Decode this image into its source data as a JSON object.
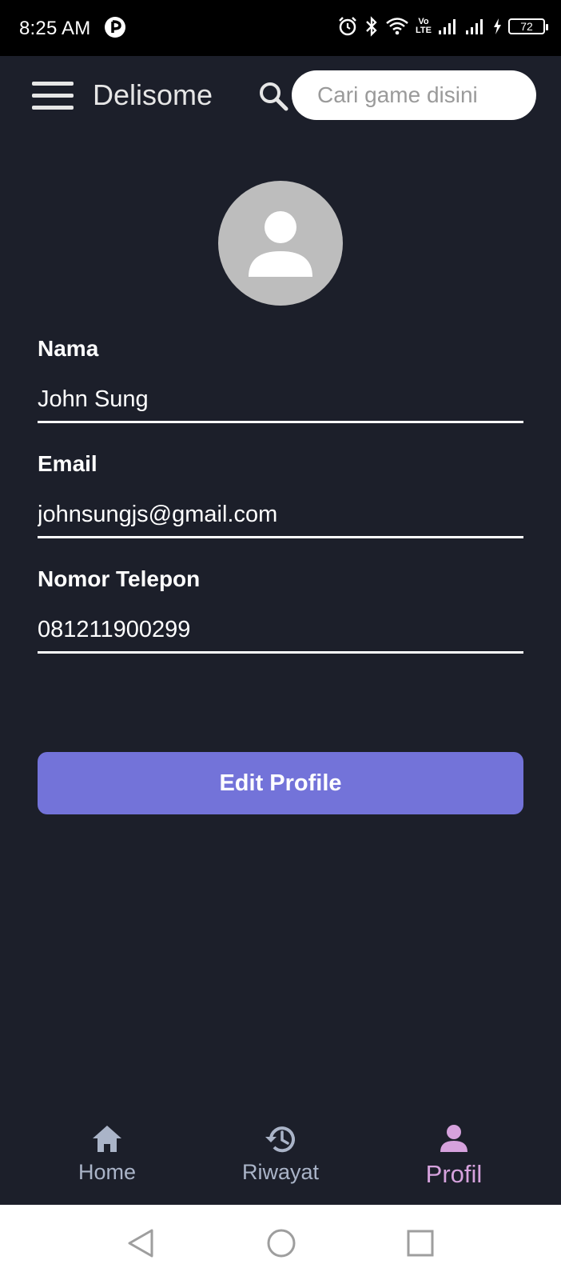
{
  "status_bar": {
    "time": "8:25 AM",
    "battery": "72",
    "lte_top": "Vo",
    "lte_bottom": "LTE"
  },
  "header": {
    "app_title": "Delisome",
    "search_placeholder": "Cari game disini"
  },
  "profile": {
    "fields": [
      {
        "label": "Nama",
        "value": "John Sung"
      },
      {
        "label": "Email",
        "value": "johnsungjs@gmail.com"
      },
      {
        "label": "Nomor Telepon",
        "value": "081211900299"
      }
    ],
    "edit_button_label": "Edit Profile"
  },
  "bottom_nav": {
    "items": [
      {
        "label": "Home",
        "icon": "home-icon",
        "active": false
      },
      {
        "label": "Riwayat",
        "icon": "history-icon",
        "active": false
      },
      {
        "label": "Profil",
        "icon": "person-icon",
        "active": true
      }
    ]
  },
  "colors": {
    "background": "#1c1f2a",
    "accent_button": "#7373d9",
    "active_nav": "#d6a2dd",
    "inactive_nav": "#aab4c8"
  }
}
